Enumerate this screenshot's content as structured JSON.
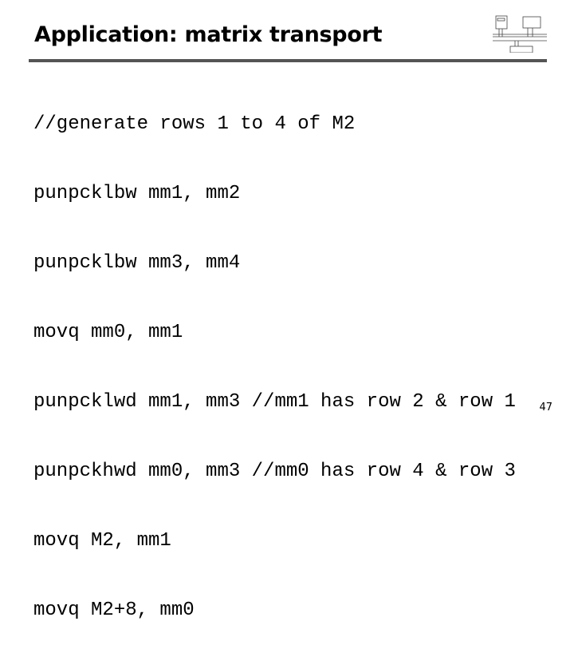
{
  "slide": {
    "title": "Application: matrix transport",
    "code_lines": [
      "//generate rows 1 to 4 of M2",
      "punpcklbw mm1, mm2",
      "punpcklbw mm3, mm4",
      "movq mm0, mm1",
      "punpcklwd mm1, mm3 //mm1 has row 2 & row 1",
      "punpckhwd mm0, mm3 //mm0 has row 4 & row 3",
      "movq M2, mm1",
      "movq M2+8, mm0"
    ],
    "page_number": "47",
    "logo_icon": "architecture-diagram-icon"
  }
}
